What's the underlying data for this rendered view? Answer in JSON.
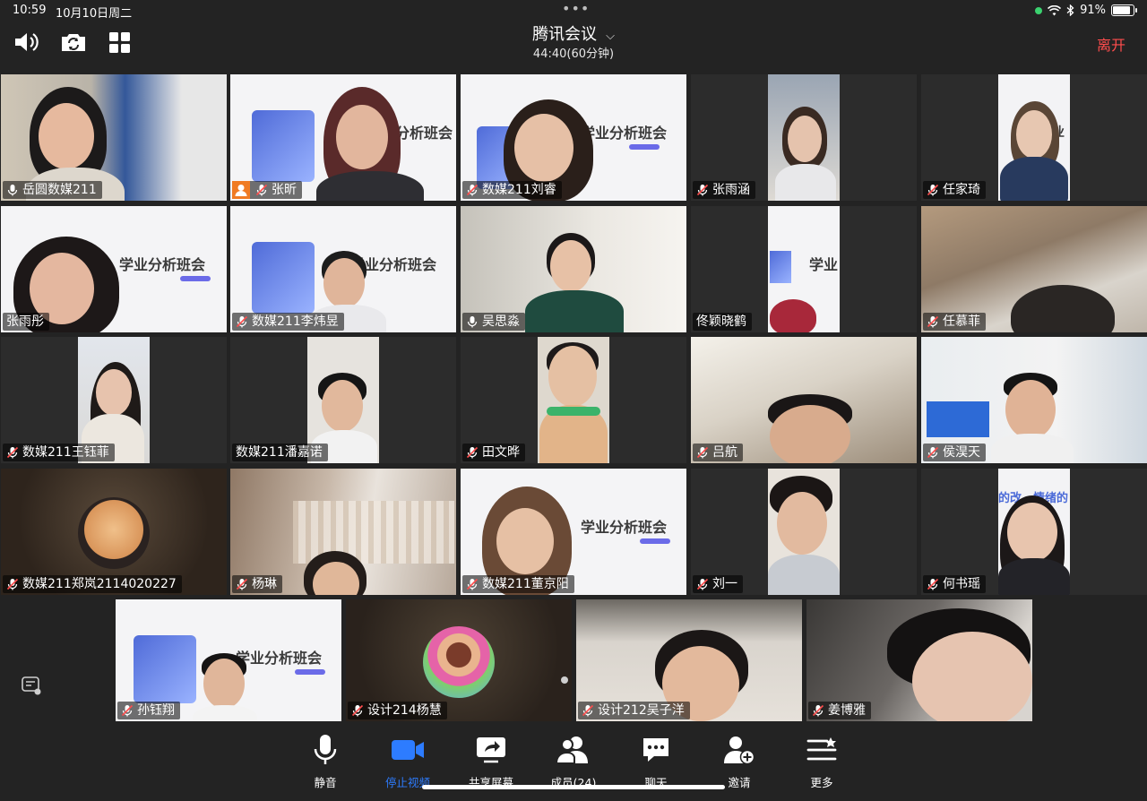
{
  "status_bar": {
    "time": "10:59",
    "date": "10月10日周二",
    "battery": "91%"
  },
  "top_bar": {
    "title": "腾讯会议",
    "timer": "44:40(60分钟)",
    "leave_label": "离开"
  },
  "participants": [
    {
      "name": "岳圆数媒211",
      "mic": "on",
      "speaking": true,
      "row": 0,
      "col": 0
    },
    {
      "name": "张昕",
      "mic": "muted",
      "host": true,
      "row": 0,
      "col": 1
    },
    {
      "name": "数媒211刘睿",
      "mic": "muted",
      "row": 0,
      "col": 2
    },
    {
      "name": "张雨涵",
      "mic": "muted",
      "row": 0,
      "col": 3
    },
    {
      "name": "任家琦",
      "mic": "muted",
      "row": 0,
      "col": 4
    },
    {
      "name": "张雨彤",
      "mic": "none",
      "row": 1,
      "col": 0
    },
    {
      "name": "数媒211李炜昱",
      "mic": "muted",
      "row": 1,
      "col": 1
    },
    {
      "name": "吴思淼",
      "mic": "on",
      "row": 1,
      "col": 2
    },
    {
      "name": "佟颖晓鹤",
      "mic": "none",
      "row": 1,
      "col": 3
    },
    {
      "name": "任慕菲",
      "mic": "muted",
      "row": 1,
      "col": 4
    },
    {
      "name": "数媒211王钰菲",
      "mic": "muted",
      "row": 2,
      "col": 0
    },
    {
      "name": "数媒211潘嘉诺",
      "mic": "none",
      "row": 2,
      "col": 1
    },
    {
      "name": "田文晔",
      "mic": "muted",
      "row": 2,
      "col": 2
    },
    {
      "name": "吕航",
      "mic": "muted",
      "row": 2,
      "col": 3
    },
    {
      "name": "侯淏天",
      "mic": "muted",
      "row": 2,
      "col": 4
    },
    {
      "name": "数媒211郑岚2114020227",
      "mic": "muted",
      "row": 3,
      "col": 0
    },
    {
      "name": "杨琳",
      "mic": "muted",
      "row": 3,
      "col": 1
    },
    {
      "name": "数媒211董京阳",
      "mic": "muted",
      "row": 3,
      "col": 2
    },
    {
      "name": "刘一",
      "mic": "muted",
      "row": 3,
      "col": 3
    },
    {
      "name": "何书瑶",
      "mic": "muted",
      "row": 3,
      "col": 4
    },
    {
      "name": "孙钰翔",
      "mic": "muted",
      "row": 4,
      "col": 0
    },
    {
      "name": "设计214杨慧",
      "mic": "muted",
      "row": 4,
      "col": 1
    },
    {
      "name": "设计212吴子洋",
      "mic": "muted",
      "row": 4,
      "col": 2
    },
    {
      "name": "姜博雅",
      "mic": "muted",
      "row": 4,
      "col": 3
    }
  ],
  "slide_text": {
    "title": "学业分析班会",
    "title_partial": "分析班会",
    "title_partial2": "学业",
    "title_partial3": "业",
    "title_right": "的改…情绪的"
  },
  "bottom_bar": {
    "mute": "静音",
    "stop_video": "停止视频",
    "share_screen": "共享屏幕",
    "members": "成员(24)",
    "chat": "聊天",
    "invite": "邀请",
    "more": "更多"
  },
  "colors": {
    "accent": "#2d7cff",
    "leave": "#ff4d4d",
    "speaking_outline": "#25c25c",
    "host_badge": "#f07b23"
  }
}
